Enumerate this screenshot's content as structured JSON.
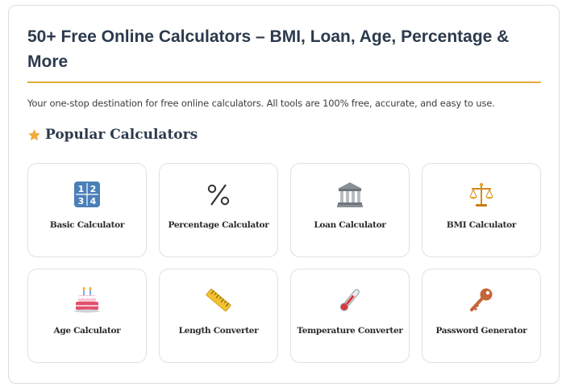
{
  "header": {
    "title": "50+ Free Online Calculators – BMI, Loan, Age, Percentage & More",
    "intro": "Your one-stop destination for free online calculators. All tools are 100% free, accurate, and easy to use."
  },
  "section": {
    "heading": "Popular Calculators",
    "icon": "star-icon",
    "accent_color": "#f2a93b"
  },
  "calculators": [
    {
      "label": "Basic Calculator",
      "icon": "numbers-keycap-icon"
    },
    {
      "label": "Percentage Calculator",
      "icon": "percent-icon"
    },
    {
      "label": "Loan Calculator",
      "icon": "bank-icon"
    },
    {
      "label": "BMI Calculator",
      "icon": "scales-icon"
    },
    {
      "label": "Age Calculator",
      "icon": "birthday-cake-icon"
    },
    {
      "label": "Length Converter",
      "icon": "ruler-icon"
    },
    {
      "label": "Temperature Converter",
      "icon": "thermometer-icon"
    },
    {
      "label": "Password Generator",
      "icon": "key-icon"
    }
  ],
  "colors": {
    "title": "#2c3a4d",
    "rule": "#e1ad37",
    "card_border": "#e0e1e4"
  }
}
